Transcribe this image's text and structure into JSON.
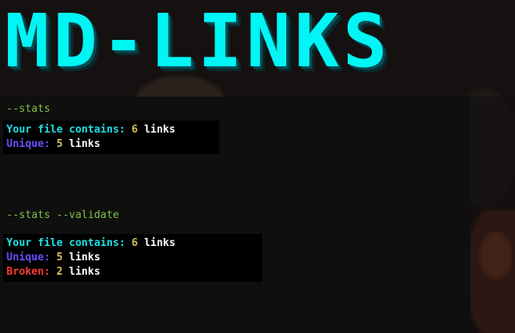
{
  "banner": {
    "title": "MD-LINKS"
  },
  "sections": [
    {
      "command": "--stats",
      "lines": [
        {
          "label": "Your file contains:",
          "value": "6",
          "unit": "links"
        },
        {
          "label": "Unique:",
          "value": "5",
          "unit": "links"
        }
      ]
    },
    {
      "command": "--stats --validate",
      "lines": [
        {
          "label": "Your file contains:",
          "value": "6",
          "unit": "links"
        },
        {
          "label": "Unique:",
          "value": "5",
          "unit": "links"
        },
        {
          "label": "Broken:",
          "value": "2",
          "unit": "links"
        }
      ]
    }
  ],
  "colors": {
    "banner": "#00f5f5",
    "command": "#7ec245",
    "total_label": "#1fe0e6",
    "unique_label": "#6a4cff",
    "broken_label": "#ff3b2f",
    "number": "#d9c25a"
  }
}
